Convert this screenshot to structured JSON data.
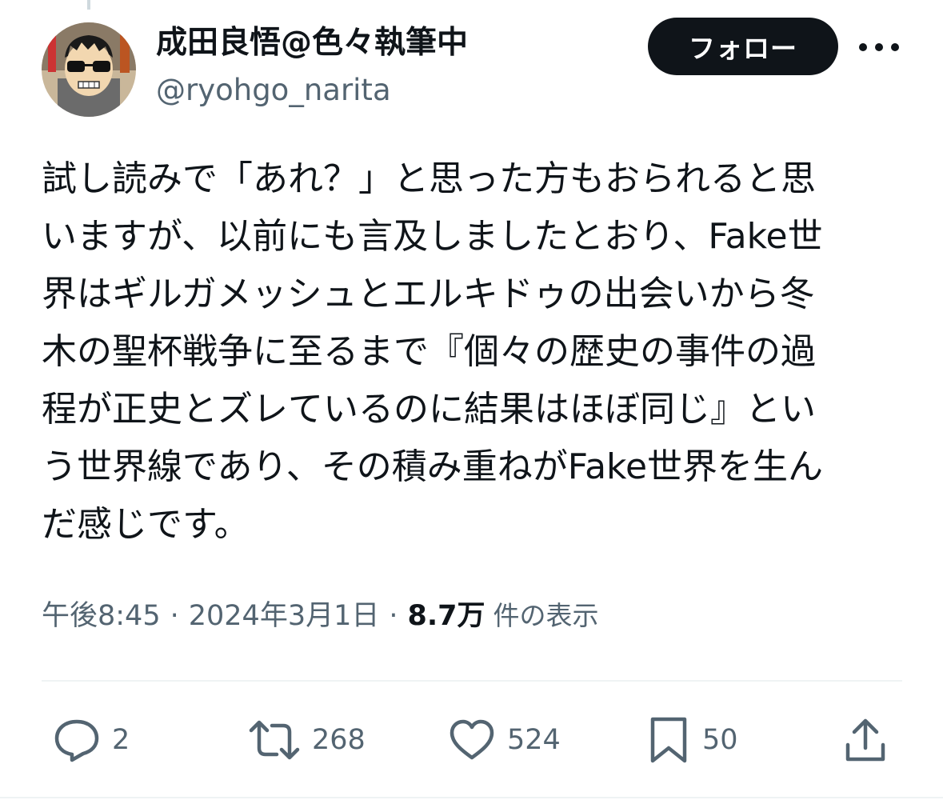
{
  "author": {
    "display_name": "成田良悟@色々執筆中",
    "handle": "@ryohgo_narita",
    "avatar_icon": "user-avatar"
  },
  "follow_label": "フォロー",
  "tweet": {
    "lines": [
      "試し読みで「あれ？」と思った方もおられると思",
      "いますが、以前にも言及しましたとおり、Fake世",
      "界はギルガメッシュとエルキドゥの出会いから冬",
      "木の聖杯戦争に至るまで『個々の歴史の事件の過",
      "程が正史とズレているのに結果はほぼ同じ』とい",
      "う世界線であり、その積み重ねがFake世界を生ん",
      "だ感じです。"
    ]
  },
  "meta": {
    "time": "午後8:45",
    "separator": "·",
    "date": "2024年3月1日",
    "views_count": "8.7万",
    "views_label": "件の表示"
  },
  "actions": {
    "reply_count": "2",
    "retweet_count": "268",
    "like_count": "524",
    "bookmark_count": "50"
  },
  "colors": {
    "text": "#0f1419",
    "secondary": "#536471",
    "divider": "#eff3f4",
    "button_bg": "#0f1419",
    "button_text": "#ffffff"
  }
}
